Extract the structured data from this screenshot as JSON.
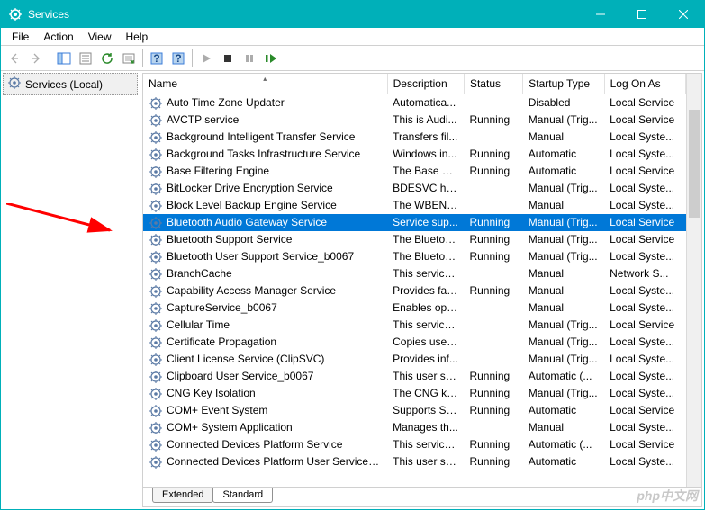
{
  "window": {
    "title": "Services"
  },
  "menu": {
    "file": "File",
    "action": "Action",
    "view": "View",
    "help": "Help"
  },
  "left": {
    "root": "Services (Local)"
  },
  "columns": {
    "name": "Name",
    "description": "Description",
    "status": "Status",
    "startup": "Startup Type",
    "logon": "Log On As"
  },
  "tabs": {
    "extended": "Extended",
    "standard": "Standard"
  },
  "watermark": "php中文网",
  "services": [
    {
      "name": "Auto Time Zone Updater",
      "desc": "Automatica...",
      "status": "",
      "startup": "Disabled",
      "logon": "Local Service"
    },
    {
      "name": "AVCTP service",
      "desc": "This is Audi...",
      "status": "Running",
      "startup": "Manual (Trig...",
      "logon": "Local Service"
    },
    {
      "name": "Background Intelligent Transfer Service",
      "desc": "Transfers fil...",
      "status": "",
      "startup": "Manual",
      "logon": "Local Syste..."
    },
    {
      "name": "Background Tasks Infrastructure Service",
      "desc": "Windows in...",
      "status": "Running",
      "startup": "Automatic",
      "logon": "Local Syste..."
    },
    {
      "name": "Base Filtering Engine",
      "desc": "The Base Fil...",
      "status": "Running",
      "startup": "Automatic",
      "logon": "Local Service"
    },
    {
      "name": "BitLocker Drive Encryption Service",
      "desc": "BDESVC hos...",
      "status": "",
      "startup": "Manual (Trig...",
      "logon": "Local Syste..."
    },
    {
      "name": "Block Level Backup Engine Service",
      "desc": "The WBENG...",
      "status": "",
      "startup": "Manual",
      "logon": "Local Syste..."
    },
    {
      "name": "Bluetooth Audio Gateway Service",
      "desc": "Service sup...",
      "status": "Running",
      "startup": "Manual (Trig...",
      "logon": "Local Service",
      "selected": true
    },
    {
      "name": "Bluetooth Support Service",
      "desc": "The Bluetoo...",
      "status": "Running",
      "startup": "Manual (Trig...",
      "logon": "Local Service"
    },
    {
      "name": "Bluetooth User Support Service_b0067",
      "desc": "The Bluetoo...",
      "status": "Running",
      "startup": "Manual (Trig...",
      "logon": "Local Syste..."
    },
    {
      "name": "BranchCache",
      "desc": "This service ...",
      "status": "",
      "startup": "Manual",
      "logon": "Network S..."
    },
    {
      "name": "Capability Access Manager Service",
      "desc": "Provides fac...",
      "status": "Running",
      "startup": "Manual",
      "logon": "Local Syste..."
    },
    {
      "name": "CaptureService_b0067",
      "desc": "Enables opti...",
      "status": "",
      "startup": "Manual",
      "logon": "Local Syste..."
    },
    {
      "name": "Cellular Time",
      "desc": "This service ...",
      "status": "",
      "startup": "Manual (Trig...",
      "logon": "Local Service"
    },
    {
      "name": "Certificate Propagation",
      "desc": "Copies user ...",
      "status": "",
      "startup": "Manual (Trig...",
      "logon": "Local Syste..."
    },
    {
      "name": "Client License Service (ClipSVC)",
      "desc": "Provides inf...",
      "status": "",
      "startup": "Manual (Trig...",
      "logon": "Local Syste..."
    },
    {
      "name": "Clipboard User Service_b0067",
      "desc": "This user ser...",
      "status": "Running",
      "startup": "Automatic (...",
      "logon": "Local Syste..."
    },
    {
      "name": "CNG Key Isolation",
      "desc": "The CNG ke...",
      "status": "Running",
      "startup": "Manual (Trig...",
      "logon": "Local Syste..."
    },
    {
      "name": "COM+ Event System",
      "desc": "Supports Sy...",
      "status": "Running",
      "startup": "Automatic",
      "logon": "Local Service"
    },
    {
      "name": "COM+ System Application",
      "desc": "Manages th...",
      "status": "",
      "startup": "Manual",
      "logon": "Local Syste..."
    },
    {
      "name": "Connected Devices Platform Service",
      "desc": "This service ...",
      "status": "Running",
      "startup": "Automatic (...",
      "logon": "Local Service"
    },
    {
      "name": "Connected Devices Platform User Service_b0...",
      "desc": "This user ser...",
      "status": "Running",
      "startup": "Automatic",
      "logon": "Local Syste..."
    }
  ]
}
